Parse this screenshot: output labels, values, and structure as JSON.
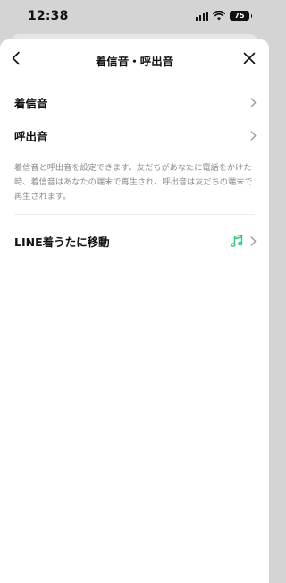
{
  "status_bar": {
    "time": "12:38",
    "battery": "75"
  },
  "header": {
    "title": "着信音・呼出音"
  },
  "menu": {
    "items": [
      {
        "label": "着信音"
      },
      {
        "label": "呼出音"
      }
    ]
  },
  "description": "着信音と呼出音を設定できます。友だちがあなたに電話をかけた時、着信音はあなたの端末で再生され、呼出音は友だちの端末で再生されます。",
  "line_melodies": {
    "label": "LINE着うたに移動"
  },
  "colors": {
    "music_icon": "#2fc77a",
    "description_text": "#8a8a8a"
  },
  "icons": [
    "signal-icon",
    "wifi-icon",
    "battery-icon",
    "back-icon",
    "close-icon",
    "chevron-right-icon",
    "music-note-icon"
  ]
}
